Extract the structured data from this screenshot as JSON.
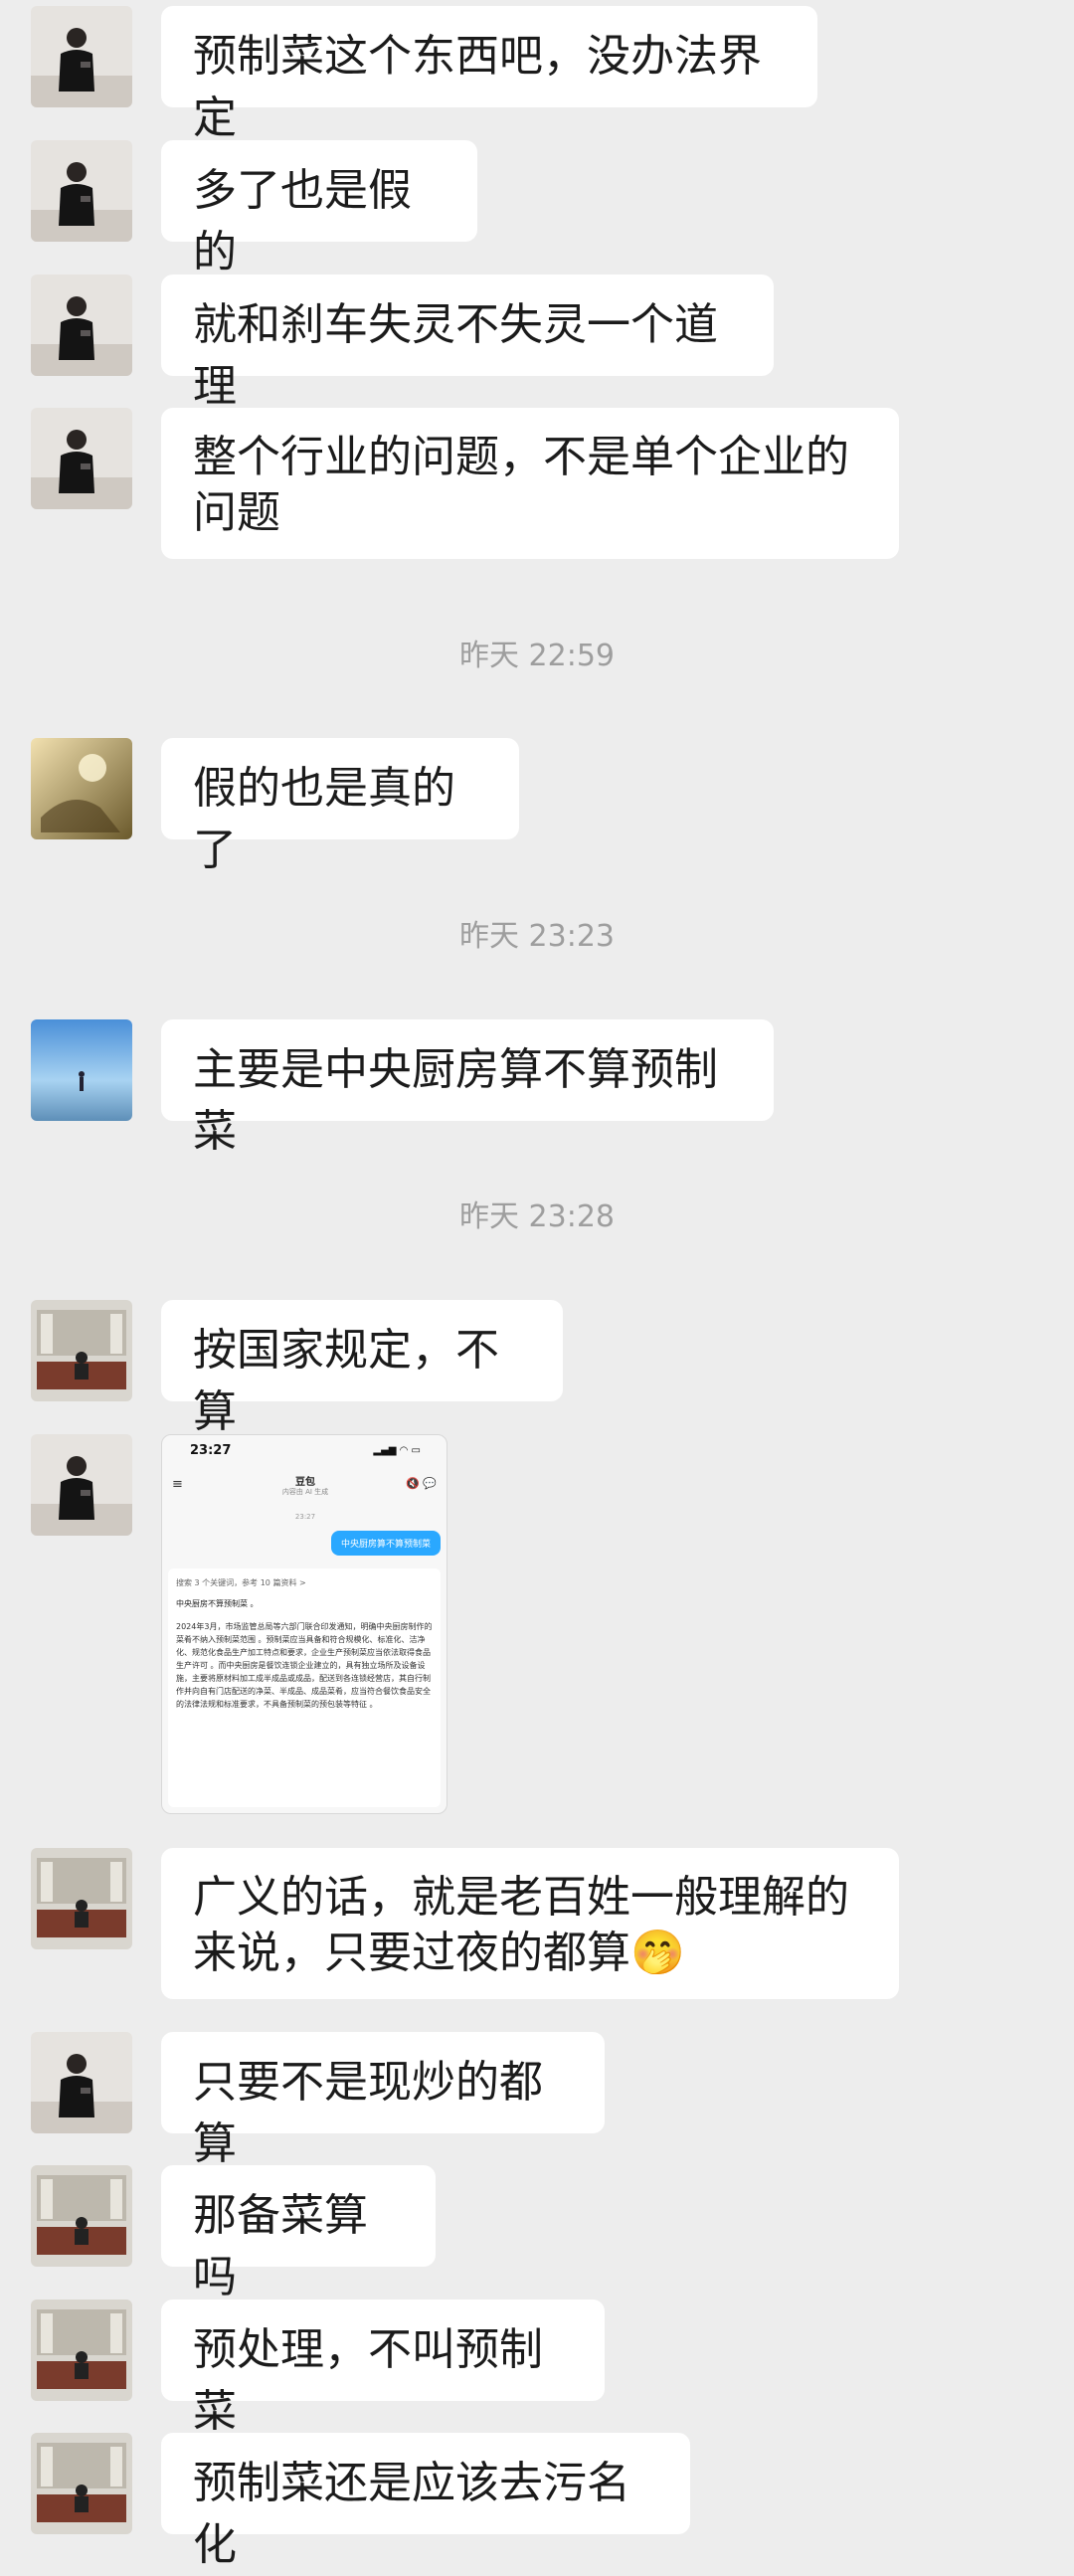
{
  "messages": [
    {
      "text": "预制菜这个东西吧，没办法界定"
    },
    {
      "text": "多了也是假的"
    },
    {
      "text": "就和刹车失灵不失灵一个道理"
    },
    {
      "text": "整个行业的问题，不是单个企业的问题"
    },
    {
      "text": "假的也是真的了"
    },
    {
      "text": "主要是中央厨房算不算预制菜"
    },
    {
      "text": "按国家规定，不算"
    },
    {
      "text": "广义的话，就是老百姓一般理解的来说，只要过夜的都算🤭"
    },
    {
      "text": "只要不是现炒的都算"
    },
    {
      "text": "那备菜算吗"
    },
    {
      "text": "预处理，不叫预制菜"
    },
    {
      "text": "预制菜还是应该去污名化"
    }
  ],
  "timestamps": [
    "昨天 22:59",
    "昨天 23:23",
    "昨天 23:28"
  ],
  "image_message": {
    "status_time": "23:27",
    "app_title": "豆包",
    "app_subtitle": "内容由 AI 生成",
    "chat_time": "23:27",
    "question": "中央厨房算不算预制菜",
    "reference": "搜索 3 个关键词，参考 10 篇资料 >",
    "answer_head": "中央厨房不算预制菜 。",
    "answer_body": "2024年3月，市场监管总局等六部门联合印发通知，明确中央厨房制作的菜肴不纳入预制菜范围 。预制菜应当具备和符合规模化、标准化、洁净化、规范化食品生产加工特点和要求，企业生产预制菜应当依法取得食品生产许可 。而中央厨房是餐饮连锁企业建立的，具有独立场所及设备设施，主要将原材料加工成半成品或成品，配送到各连锁经营店，其自行制作并向自有门店配送的净菜、半成品、成品菜肴，应当符合餐饮食品安全的法律法规和标准要求，不具备预制菜的预包装等特征 。"
  },
  "avatars": [
    "man-phone-avatar",
    "hands-sunlight-avatar",
    "sky-figure-avatar",
    "nyse-avatar"
  ]
}
